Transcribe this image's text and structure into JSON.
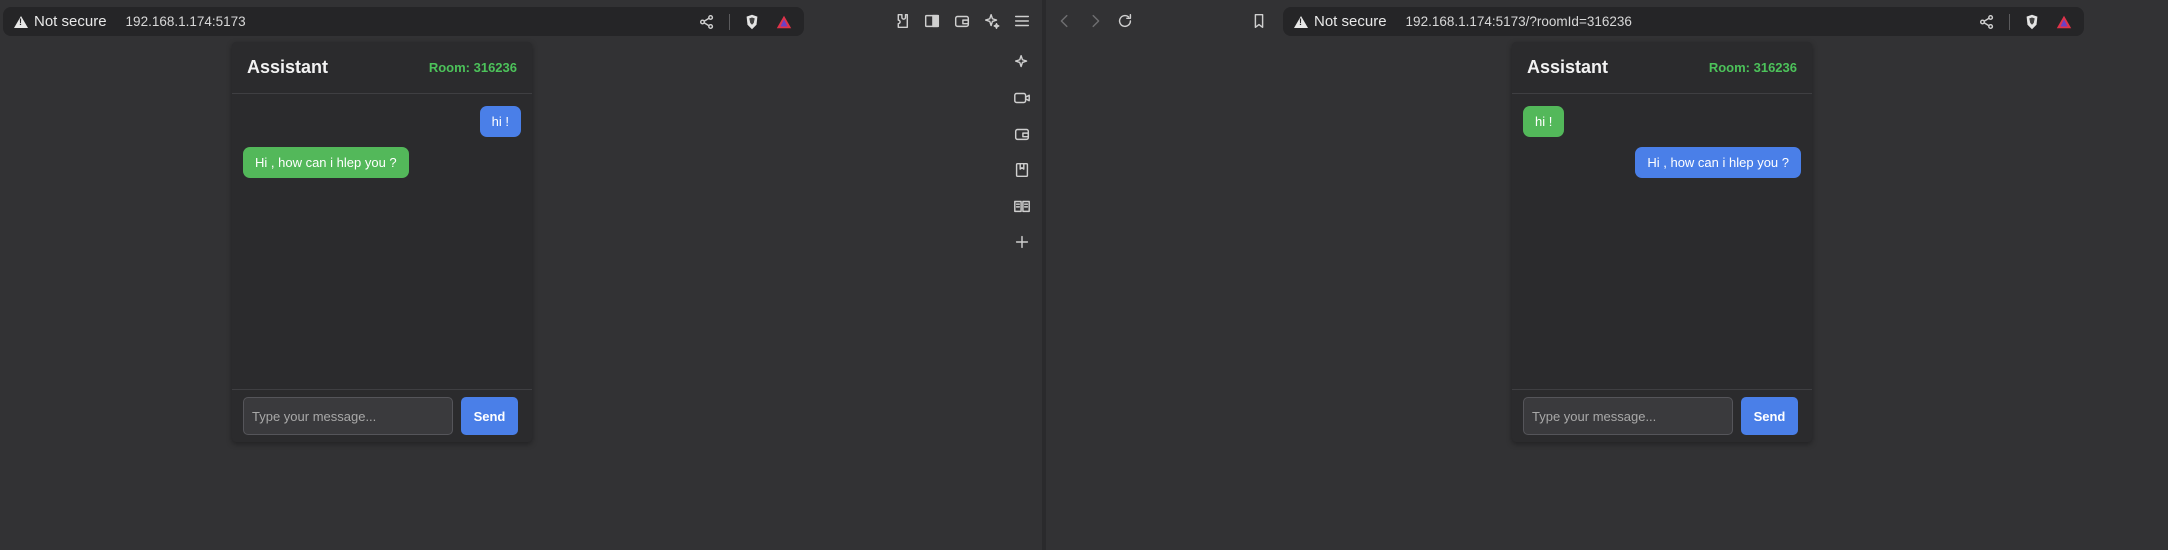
{
  "left": {
    "urlbar": {
      "security": "Not secure",
      "url": "192.168.1.174:5173"
    },
    "toolbar_icons": [
      "extensions-icon",
      "sidebar-icon",
      "wallet-icon",
      "leo-ai-icon",
      "menu-icon"
    ],
    "side_rail_icons": [
      "leo-ai-icon",
      "video-icon",
      "wallet-icon",
      "bookmarks-icon",
      "reading-list-icon",
      "add-icon"
    ],
    "chat": {
      "title": "Assistant",
      "room": "Room: 316236",
      "messages": [
        {
          "text": "hi !",
          "side": "right",
          "color": "blue"
        },
        {
          "text": "Hi , how can i hlep you ?",
          "side": "left",
          "color": "green"
        }
      ],
      "input_placeholder": "Type your message...",
      "send_label": "Send"
    }
  },
  "right": {
    "urlbar": {
      "security": "Not secure",
      "url": "192.168.1.174:5173/?roomId=316236"
    },
    "nav_icons": [
      "back-icon",
      "forward-icon",
      "reload-icon",
      "bookmark-icon"
    ],
    "chat": {
      "title": "Assistant",
      "room": "Room: 316236",
      "messages": [
        {
          "text": "hi !",
          "side": "left",
          "color": "green"
        },
        {
          "text": "Hi , how can i hlep you ?",
          "side": "right",
          "color": "blue"
        }
      ],
      "input_placeholder": "Type your message...",
      "send_label": "Send"
    }
  },
  "colors": {
    "accent_blue": "#4a7fe8",
    "accent_green": "#53b85a",
    "room_green": "#4cc25a",
    "background": "#323234"
  }
}
